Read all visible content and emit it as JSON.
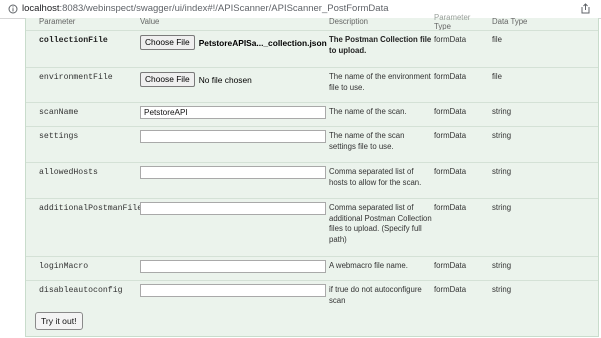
{
  "browser": {
    "url_host": "localhost",
    "url_path": ":8083/webinspect/swagger/ui/index#!/APIScanner/APIScanner_PostFormData"
  },
  "columns": {
    "parameter": "Parameter",
    "value": "Value",
    "description": "Description",
    "parameter_type_line1": "Parameter",
    "parameter_type_line2": "Type",
    "data_type": "Data Type"
  },
  "params": [
    {
      "name": "collectionFile",
      "required": true,
      "input": "file",
      "button_label": "Choose File",
      "file_text": "PetstoreAPISa..._collection.json",
      "description": "The Postman Collection file to upload.",
      "param_type": "formData",
      "data_type": "file"
    },
    {
      "name": "environmentFile",
      "required": false,
      "input": "file",
      "button_label": "Choose File",
      "file_text": "No file chosen",
      "description": "The name of the environment file to use.",
      "param_type": "formData",
      "data_type": "file"
    },
    {
      "name": "scanName",
      "required": false,
      "input": "text",
      "value": "PetstoreAPI",
      "description": "The name of the scan.",
      "param_type": "formData",
      "data_type": "string"
    },
    {
      "name": "settings",
      "required": false,
      "input": "text",
      "value": "",
      "description": "The name of the scan settings file to use.",
      "param_type": "formData",
      "data_type": "string"
    },
    {
      "name": "allowedHosts",
      "required": false,
      "input": "text",
      "value": "",
      "description": "Comma separated list of hosts to allow for the scan.",
      "param_type": "formData",
      "data_type": "string"
    },
    {
      "name": "additionalPostmanFiles",
      "required": false,
      "input": "text",
      "value": "",
      "description": "Comma separated list of additional Postman Collection files to upload. (Specify full path)",
      "param_type": "formData",
      "data_type": "string"
    },
    {
      "name": "loginMacro",
      "required": false,
      "input": "text",
      "value": "",
      "description": "A webmacro file name.",
      "param_type": "formData",
      "data_type": "string"
    },
    {
      "name": "disableautoconfig",
      "required": false,
      "input": "text",
      "value": "",
      "description": "if true do not autoconfigure scan",
      "param_type": "formData",
      "data_type": "string"
    }
  ],
  "try_button_label": "Try it out!"
}
